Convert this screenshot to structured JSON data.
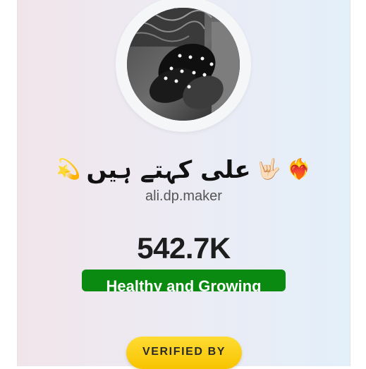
{
  "profile": {
    "display_name": "علی کہتے ہیں",
    "username": "ali.dp.maker",
    "emoji_left": "💫",
    "emoji_middle": "🤟🏻",
    "emoji_right": "❤️‍🔥"
  },
  "stats": {
    "followers": "542.7K",
    "health_label": "Healthy and Growing"
  },
  "badge": {
    "verified_label": "VERIFIED BY"
  },
  "colors": {
    "health_bg": "#0a8a10",
    "verified_bg": "#f7c400"
  },
  "icons": {
    "avatar": "profile-photo"
  }
}
